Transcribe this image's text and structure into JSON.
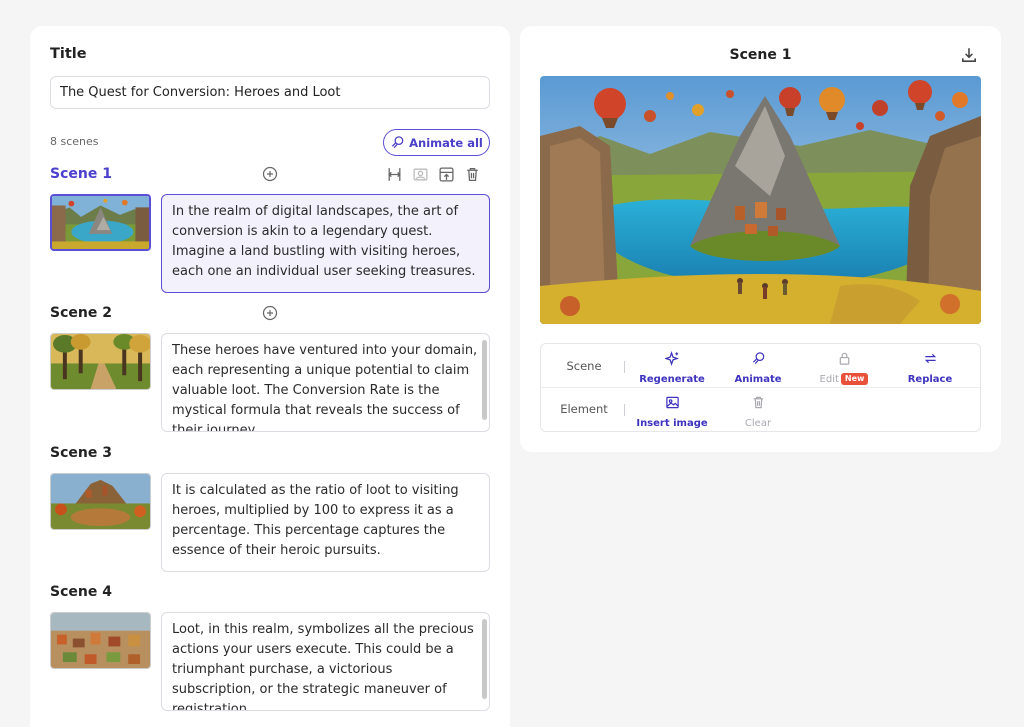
{
  "editor": {
    "title_label": "Title",
    "title_value": "The Quest for Conversion: Heroes and Loot",
    "scene_count": "8 scenes",
    "animate_all_label": "Animate all"
  },
  "scenes": [
    {
      "title": "Scene 1",
      "text": "In the realm of digital landscapes, the art of conversion is akin to a legendary quest. Imagine a land bustling with visiting heroes, each one an individual user seeking treasures."
    },
    {
      "title": "Scene 2",
      "text": "These heroes have ventured into your domain, each representing a unique potential to claim valuable loot. The Conversion Rate is the mystical formula that reveals the success of their journey"
    },
    {
      "title": "Scene 3",
      "text": "It is calculated as the ratio of loot to visiting heroes, multiplied by 100 to express it as a percentage. This percentage captures the essence of their heroic pursuits."
    },
    {
      "title": "Scene 4",
      "text": "Loot, in this realm, symbolizes all the precious actions your users execute. This could be a triumphant purchase, a victorious subscription, or the strategic maneuver of registration"
    }
  ],
  "preview": {
    "title": "Scene 1"
  },
  "tools": {
    "scene_row_label": "Scene",
    "element_row_label": "Element",
    "regenerate": "Regenerate",
    "animate": "Animate",
    "edit": "Edit",
    "edit_badge": "New",
    "replace": "Replace",
    "insert_image": "Insert image",
    "clear": "Clear"
  },
  "colors": {
    "accent": "#4b3fd0",
    "badge": "#e8513a",
    "panel_bg": "#ffffff",
    "page_bg": "#f5f5f6"
  }
}
